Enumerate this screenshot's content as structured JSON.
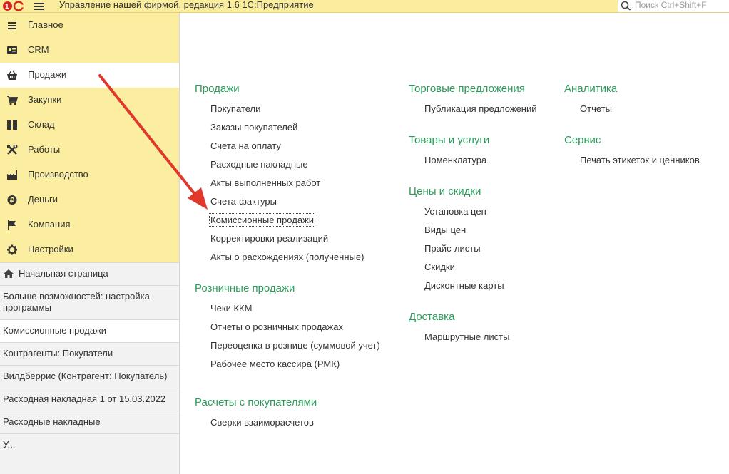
{
  "app": {
    "title": "Управление нашей фирмой, редакция 1.6 1С:Предприятие",
    "logo_text": "1С",
    "search_placeholder": "Поиск Ctrl+Shift+F"
  },
  "sections": [
    {
      "label": "Главное",
      "icon": "list-icon"
    },
    {
      "label": "CRM",
      "icon": "crm-card-icon"
    },
    {
      "label": "Продажи",
      "icon": "basket-icon",
      "active": true
    },
    {
      "label": "Закупки",
      "icon": "cart-icon"
    },
    {
      "label": "Склад",
      "icon": "warehouse-grid-icon"
    },
    {
      "label": "Работы",
      "icon": "tools-icon"
    },
    {
      "label": "Производство",
      "icon": "factory-icon"
    },
    {
      "label": "Деньги",
      "icon": "ruble-coin-icon"
    },
    {
      "label": "Компания",
      "icon": "flag-icon"
    },
    {
      "label": "Настройки",
      "icon": "gear-icon"
    }
  ],
  "history": [
    {
      "label": "Начальная страница",
      "icon": "home-icon"
    },
    {
      "label": "Больше возможностей: настройка программы"
    },
    {
      "label": "Комиссионные продажи",
      "active": true
    },
    {
      "label": "Контрагенты: Покупатели"
    },
    {
      "label": "Вилдберрис (Контрагент: Покупатель)"
    },
    {
      "label": "Расходная накладная 1 от 15.03.2022"
    },
    {
      "label": "Расходные накладные"
    },
    {
      "label": "У..."
    }
  ],
  "columns": {
    "col1": {
      "groups": [
        {
          "title": "Продажи",
          "items": [
            "Покупатели",
            "Заказы покупателей",
            "Счета на оплату",
            "Расходные накладные",
            "Акты выполненных работ",
            "Счета-фактуры",
            "Комиссионные продажи",
            "Корректировки реализаций",
            "Акты о расхождениях (полученные)"
          ]
        },
        {
          "title": "Розничные продажи",
          "items": [
            "Чеки ККМ",
            "Отчеты о розничных продажах",
            "Переоценка в рознице (суммовой учет)",
            "Рабочее место кассира (РМК)"
          ]
        },
        {
          "title": "Расчеты с покупателями",
          "items": [
            "Сверки взаиморасчетов"
          ]
        }
      ]
    },
    "col2": {
      "groups": [
        {
          "title": "Торговые предложения",
          "items": [
            "Публикация предложений"
          ]
        },
        {
          "title": "Товары и услуги",
          "items": [
            "Номенклатура"
          ]
        },
        {
          "title": "Цены и скидки",
          "items": [
            "Установка цен",
            "Виды цен",
            "Прайс-листы",
            "Скидки",
            "Дисконтные карты"
          ]
        },
        {
          "title": "Доставка",
          "items": [
            "Маршрутные листы"
          ]
        }
      ]
    },
    "col3": {
      "groups": [
        {
          "title": "Аналитика",
          "items": [
            "Отчеты"
          ]
        },
        {
          "title": "Сервис",
          "items": [
            "Печать этикеток и ценников"
          ]
        }
      ]
    }
  },
  "colors": {
    "accent_green": "#2a9c5a",
    "panel_yellow": "#fbeea0",
    "arrow_red": "#e0382b"
  }
}
